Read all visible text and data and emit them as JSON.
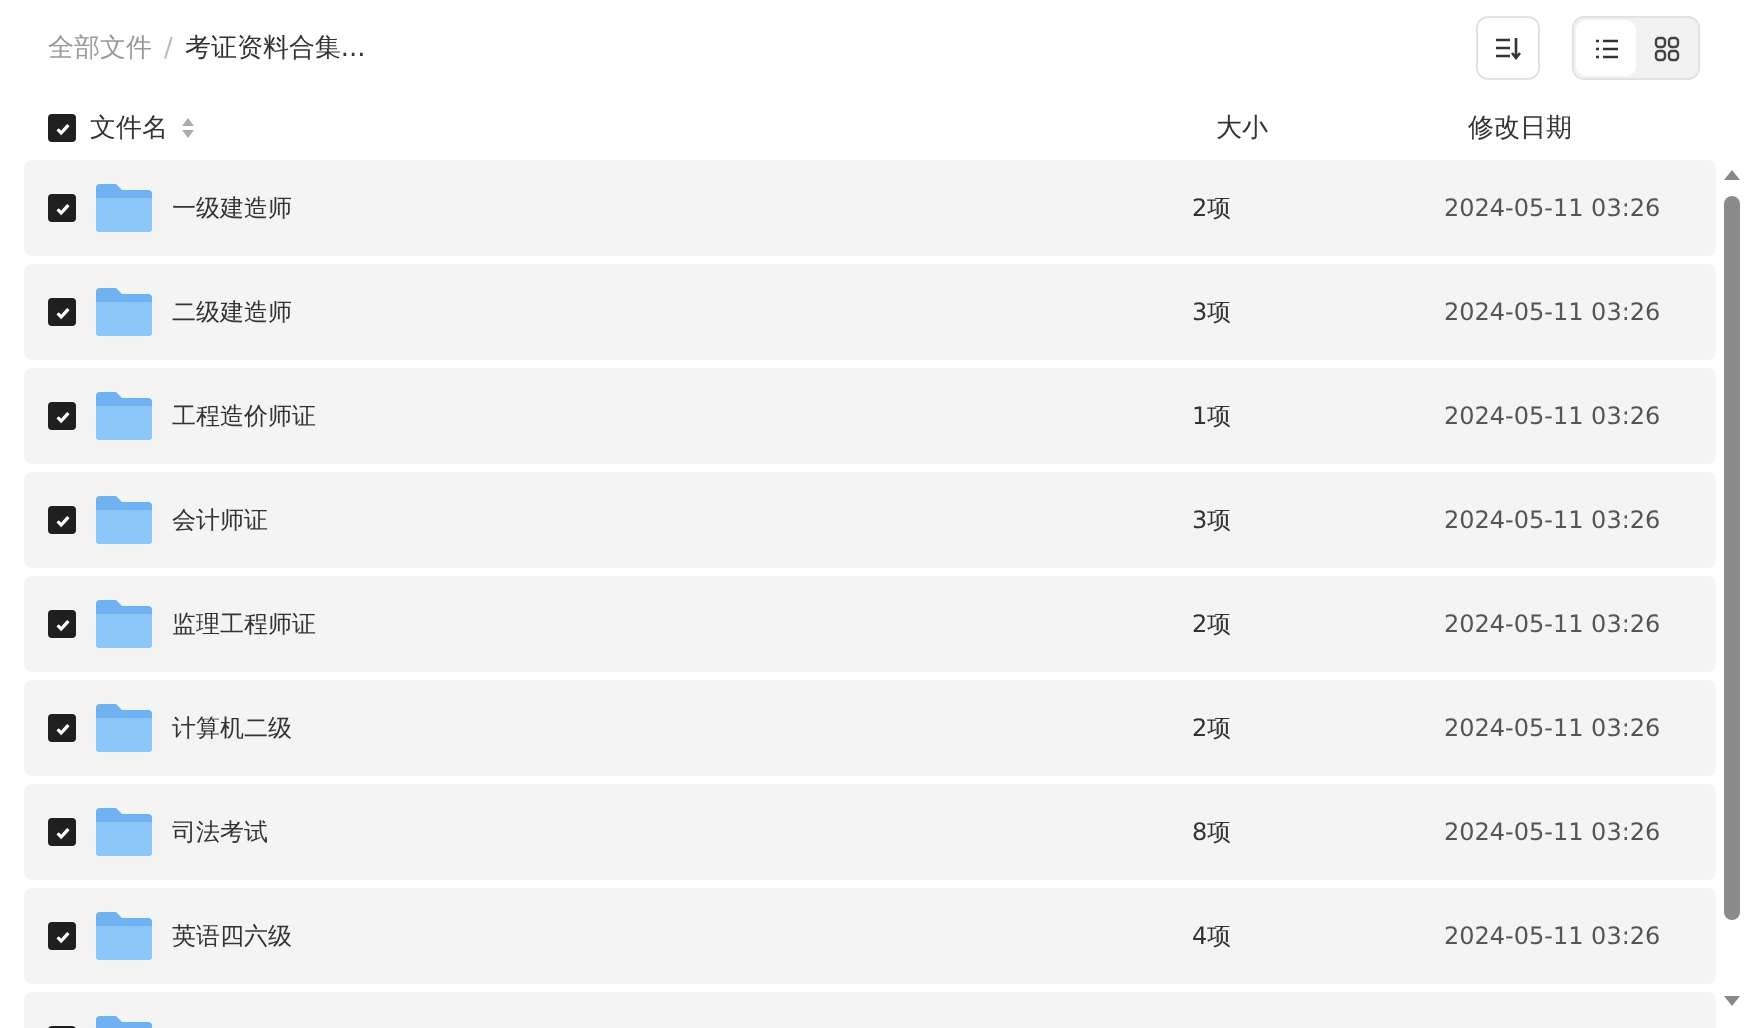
{
  "breadcrumb": [
    {
      "label": "全部文件",
      "current": false
    },
    {
      "label": "/",
      "kind": "separator"
    },
    {
      "label": "考证资料合集...",
      "current": true
    }
  ],
  "view_modes": [
    {
      "kind": "list",
      "selected": true
    },
    {
      "kind": "grid",
      "selected": false
    }
  ],
  "table": {
    "select_all": {
      "checked": true
    },
    "columns": [
      {
        "label": "文件名",
        "sortable": true
      },
      {
        "label": "大小"
      },
      {
        "label": "修改日期"
      }
    ],
    "rows": [
      {
        "name": "一级建造师",
        "size": "2项",
        "modified": "2024-05-11 03:26",
        "checked": true
      },
      {
        "name": "二级建造师",
        "size": "3项",
        "modified": "2024-05-11 03:26",
        "checked": true
      },
      {
        "name": "工程造价师证",
        "size": "1项",
        "modified": "2024-05-11 03:26",
        "checked": true
      },
      {
        "name": "会计师证",
        "size": "3项",
        "modified": "2024-05-11 03:26",
        "checked": true
      },
      {
        "name": "监理工程师证",
        "size": "2项",
        "modified": "2024-05-11 03:26",
        "checked": true
      },
      {
        "name": "计算机二级",
        "size": "2项",
        "modified": "2024-05-11 03:26",
        "checked": true
      },
      {
        "name": "司法考试",
        "size": "8项",
        "modified": "2024-05-11 03:26",
        "checked": true
      },
      {
        "name": "英语四六级",
        "size": "4项",
        "modified": "2024-05-11 03:26",
        "checked": true
      },
      {
        "checked": true
      }
    ]
  }
}
